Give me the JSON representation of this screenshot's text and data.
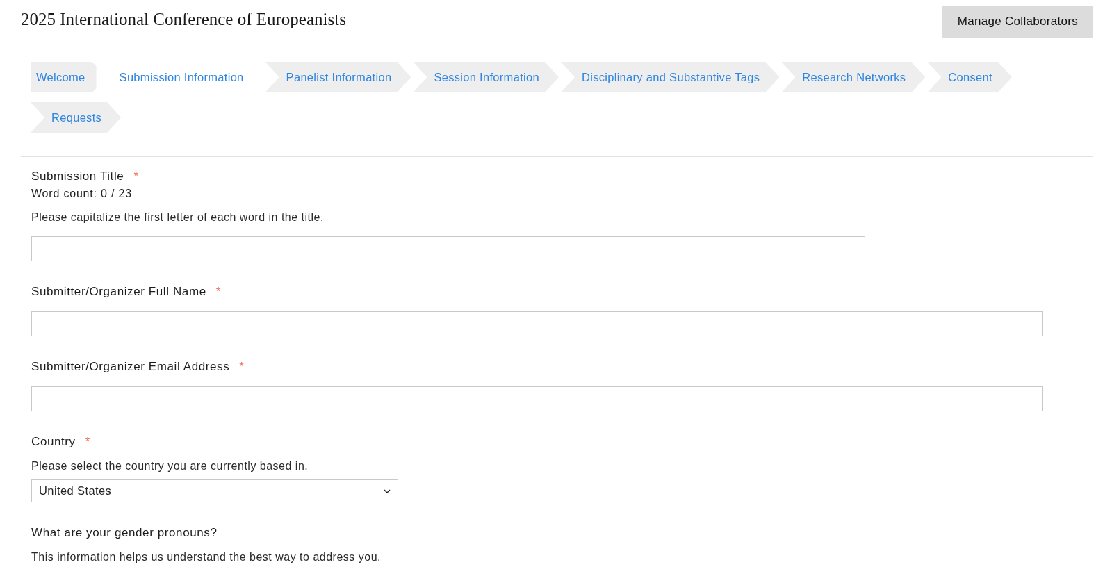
{
  "header": {
    "title": "2025 International Conference of Europeanists",
    "button": "Manage Collaborators"
  },
  "steps": [
    {
      "label": "Welcome",
      "kind": "first",
      "selected": false
    },
    {
      "label": "Submission Information",
      "kind": "chevron",
      "selected": true
    },
    {
      "label": "Panelist Information",
      "kind": "chevron",
      "selected": false
    },
    {
      "label": "Session Information",
      "kind": "chevron",
      "selected": false
    },
    {
      "label": "Disciplinary and Substantive Tags",
      "kind": "chevron",
      "selected": false
    },
    {
      "label": "Research Networks",
      "kind": "chevron",
      "selected": false
    },
    {
      "label": "Consent",
      "kind": "chevron",
      "selected": false
    },
    {
      "label": "Requests",
      "kind": "chevron",
      "selected": false
    }
  ],
  "fields": [
    {
      "kind": "text",
      "label": "Submission Title",
      "required_mark": "*",
      "word_count": "Word count: 0 / 23",
      "help": "Please capitalize the first letter of each word in the title."
    },
    {
      "kind": "text",
      "label": "Submitter/Organizer Full Name",
      "required_mark": "*"
    },
    {
      "kind": "text",
      "label": "Submitter/Organizer Email Address",
      "required_mark": "*"
    },
    {
      "kind": "select",
      "label": "Country",
      "required_mark": "*",
      "help": "Please select the country you are currently based in.",
      "value": "United States"
    },
    {
      "kind": "question",
      "label": "What are your gender pronouns?",
      "help": "This information helps us understand the best way to address you."
    }
  ]
}
